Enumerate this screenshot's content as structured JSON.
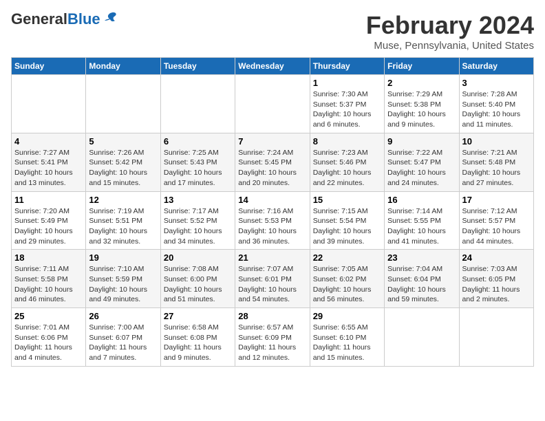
{
  "header": {
    "logo_general": "General",
    "logo_blue": "Blue",
    "month_title": "February 2024",
    "location": "Muse, Pennsylvania, United States"
  },
  "days_of_week": [
    "Sunday",
    "Monday",
    "Tuesday",
    "Wednesday",
    "Thursday",
    "Friday",
    "Saturday"
  ],
  "weeks": [
    [
      {
        "day": "",
        "info": ""
      },
      {
        "day": "",
        "info": ""
      },
      {
        "day": "",
        "info": ""
      },
      {
        "day": "",
        "info": ""
      },
      {
        "day": "1",
        "info": "Sunrise: 7:30 AM\nSunset: 5:37 PM\nDaylight: 10 hours\nand 6 minutes."
      },
      {
        "day": "2",
        "info": "Sunrise: 7:29 AM\nSunset: 5:38 PM\nDaylight: 10 hours\nand 9 minutes."
      },
      {
        "day": "3",
        "info": "Sunrise: 7:28 AM\nSunset: 5:40 PM\nDaylight: 10 hours\nand 11 minutes."
      }
    ],
    [
      {
        "day": "4",
        "info": "Sunrise: 7:27 AM\nSunset: 5:41 PM\nDaylight: 10 hours\nand 13 minutes."
      },
      {
        "day": "5",
        "info": "Sunrise: 7:26 AM\nSunset: 5:42 PM\nDaylight: 10 hours\nand 15 minutes."
      },
      {
        "day": "6",
        "info": "Sunrise: 7:25 AM\nSunset: 5:43 PM\nDaylight: 10 hours\nand 17 minutes."
      },
      {
        "day": "7",
        "info": "Sunrise: 7:24 AM\nSunset: 5:45 PM\nDaylight: 10 hours\nand 20 minutes."
      },
      {
        "day": "8",
        "info": "Sunrise: 7:23 AM\nSunset: 5:46 PM\nDaylight: 10 hours\nand 22 minutes."
      },
      {
        "day": "9",
        "info": "Sunrise: 7:22 AM\nSunset: 5:47 PM\nDaylight: 10 hours\nand 24 minutes."
      },
      {
        "day": "10",
        "info": "Sunrise: 7:21 AM\nSunset: 5:48 PM\nDaylight: 10 hours\nand 27 minutes."
      }
    ],
    [
      {
        "day": "11",
        "info": "Sunrise: 7:20 AM\nSunset: 5:49 PM\nDaylight: 10 hours\nand 29 minutes."
      },
      {
        "day": "12",
        "info": "Sunrise: 7:19 AM\nSunset: 5:51 PM\nDaylight: 10 hours\nand 32 minutes."
      },
      {
        "day": "13",
        "info": "Sunrise: 7:17 AM\nSunset: 5:52 PM\nDaylight: 10 hours\nand 34 minutes."
      },
      {
        "day": "14",
        "info": "Sunrise: 7:16 AM\nSunset: 5:53 PM\nDaylight: 10 hours\nand 36 minutes."
      },
      {
        "day": "15",
        "info": "Sunrise: 7:15 AM\nSunset: 5:54 PM\nDaylight: 10 hours\nand 39 minutes."
      },
      {
        "day": "16",
        "info": "Sunrise: 7:14 AM\nSunset: 5:55 PM\nDaylight: 10 hours\nand 41 minutes."
      },
      {
        "day": "17",
        "info": "Sunrise: 7:12 AM\nSunset: 5:57 PM\nDaylight: 10 hours\nand 44 minutes."
      }
    ],
    [
      {
        "day": "18",
        "info": "Sunrise: 7:11 AM\nSunset: 5:58 PM\nDaylight: 10 hours\nand 46 minutes."
      },
      {
        "day": "19",
        "info": "Sunrise: 7:10 AM\nSunset: 5:59 PM\nDaylight: 10 hours\nand 49 minutes."
      },
      {
        "day": "20",
        "info": "Sunrise: 7:08 AM\nSunset: 6:00 PM\nDaylight: 10 hours\nand 51 minutes."
      },
      {
        "day": "21",
        "info": "Sunrise: 7:07 AM\nSunset: 6:01 PM\nDaylight: 10 hours\nand 54 minutes."
      },
      {
        "day": "22",
        "info": "Sunrise: 7:05 AM\nSunset: 6:02 PM\nDaylight: 10 hours\nand 56 minutes."
      },
      {
        "day": "23",
        "info": "Sunrise: 7:04 AM\nSunset: 6:04 PM\nDaylight: 10 hours\nand 59 minutes."
      },
      {
        "day": "24",
        "info": "Sunrise: 7:03 AM\nSunset: 6:05 PM\nDaylight: 11 hours\nand 2 minutes."
      }
    ],
    [
      {
        "day": "25",
        "info": "Sunrise: 7:01 AM\nSunset: 6:06 PM\nDaylight: 11 hours\nand 4 minutes."
      },
      {
        "day": "26",
        "info": "Sunrise: 7:00 AM\nSunset: 6:07 PM\nDaylight: 11 hours\nand 7 minutes."
      },
      {
        "day": "27",
        "info": "Sunrise: 6:58 AM\nSunset: 6:08 PM\nDaylight: 11 hours\nand 9 minutes."
      },
      {
        "day": "28",
        "info": "Sunrise: 6:57 AM\nSunset: 6:09 PM\nDaylight: 11 hours\nand 12 minutes."
      },
      {
        "day": "29",
        "info": "Sunrise: 6:55 AM\nSunset: 6:10 PM\nDaylight: 11 hours\nand 15 minutes."
      },
      {
        "day": "",
        "info": ""
      },
      {
        "day": "",
        "info": ""
      }
    ]
  ]
}
